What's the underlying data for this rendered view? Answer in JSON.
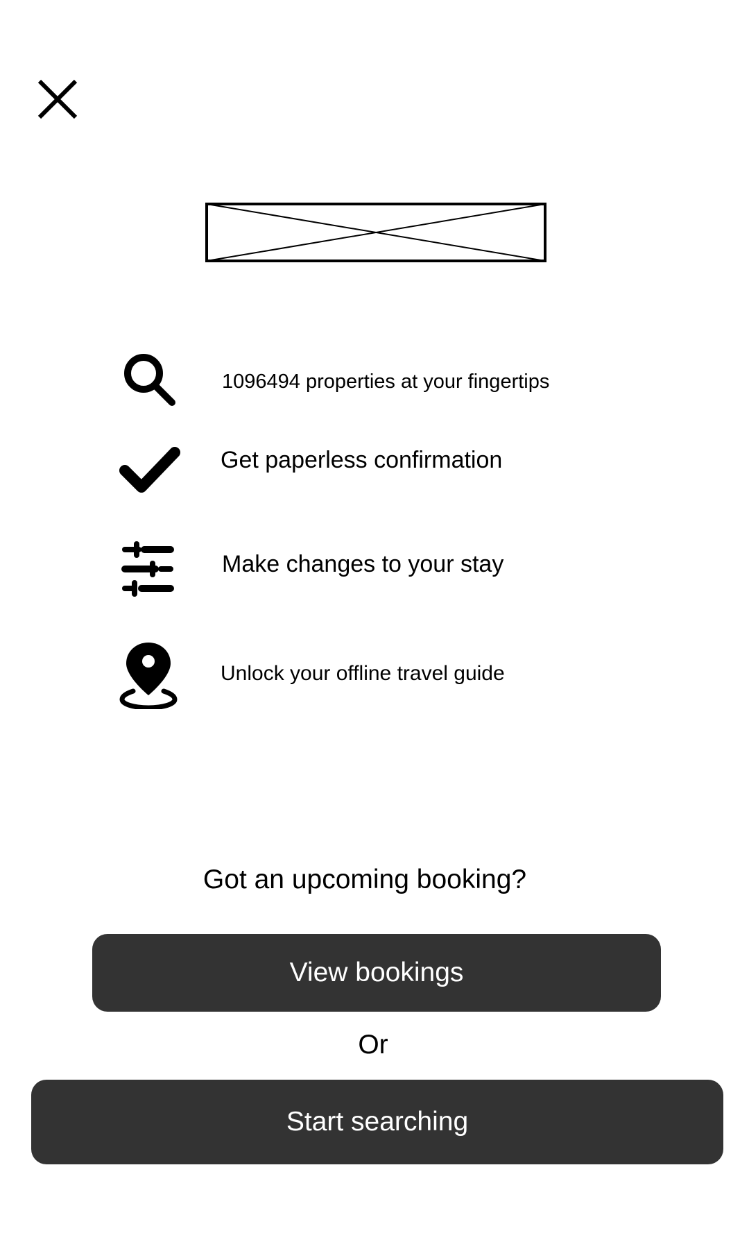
{
  "header": {
    "close_icon": "close-icon"
  },
  "logo": {
    "icon": "image-placeholder-icon"
  },
  "features": [
    {
      "icon": "search-icon",
      "label": "1096494 properties at your fingertips"
    },
    {
      "icon": "checkmark-icon",
      "label": "Get paperless confirmation"
    },
    {
      "icon": "sliders-icon",
      "label": "Make changes to your stay"
    },
    {
      "icon": "location-pin-icon",
      "label": "Unlock your offline travel guide"
    }
  ],
  "booking": {
    "prompt": "Got an upcoming booking?",
    "view_button_label": "View bookings",
    "or_label": "Or",
    "start_button_label": "Start searching"
  },
  "colors": {
    "button_bg": "#333333",
    "button_text": "#ffffff",
    "text": "#000000",
    "background": "#ffffff"
  }
}
